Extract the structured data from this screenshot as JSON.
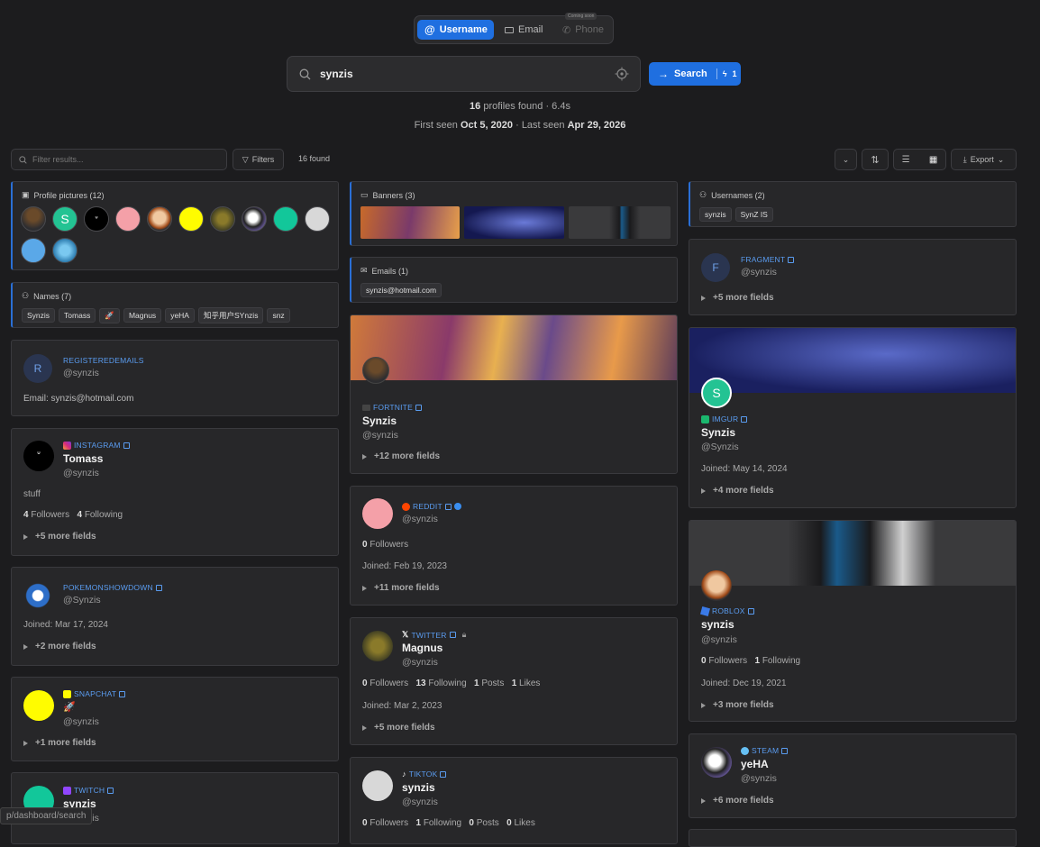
{
  "search_type": {
    "username": "Username",
    "email": "Email",
    "phone": "Phone",
    "phone_badge": "Coming soon"
  },
  "search": {
    "query": "synzis",
    "button": "Search",
    "credits": "1"
  },
  "stats": {
    "profiles_count": "16",
    "profiles_text": "profiles found · 6.4s",
    "first_label": "First seen",
    "first_date": "Oct 5, 2020",
    "sep": "· Last seen",
    "last_date": "Apr 29, 2026"
  },
  "toolbar": {
    "filter_placeholder": "Filter results...",
    "filters": "Filters",
    "found": "16 found",
    "export": "Export"
  },
  "profile_pictures": {
    "title": "Profile pictures (12)"
  },
  "names": {
    "title": "Names (7)",
    "items": [
      "Synzis",
      "Tomass",
      "🚀",
      "Magnus",
      "yeHA",
      "知乎用户SYnzis",
      "snz"
    ]
  },
  "banners": {
    "title": "Banners (3)"
  },
  "emails": {
    "title": "Emails (1)",
    "items": [
      "synzis@hotmail.com"
    ]
  },
  "usernames": {
    "title": "Usernames (2)",
    "items": [
      "synzis",
      "SynZ IS"
    ]
  },
  "registeredemails": {
    "platform": "REGISTEREDEMAILS",
    "avatar_letter": "R",
    "handle": "@synzis",
    "email_line": "Email: synzis@hotmail.com"
  },
  "instagram": {
    "platform": "INSTAGRAM",
    "name": "Tomass",
    "handle": "@synzis",
    "bio": "stuff",
    "followers": "4",
    "followers_label": "Followers",
    "following": "4",
    "following_label": "Following",
    "more": "+5 more fields"
  },
  "pokemon": {
    "platform": "POKEMONSHOWDOWN",
    "handle": "@Synzis",
    "joined": "Joined: Mar 17, 2024",
    "more": "+2 more fields"
  },
  "snapchat": {
    "platform": "SNAPCHAT",
    "name": "🚀",
    "handle": "@synzis",
    "more": "+1 more fields"
  },
  "twitch": {
    "platform": "TWITCH",
    "name": "synzis",
    "handle": "@synzis"
  },
  "fortnite": {
    "platform": "FORTNITE",
    "name": "Synzis",
    "handle": "@synzis",
    "more": "+12 more fields"
  },
  "reddit": {
    "platform": "REDDIT",
    "handle": "@synzis",
    "followers": "0",
    "followers_label": "Followers",
    "joined": "Joined: Feb 19, 2023",
    "more": "+11 more fields"
  },
  "twitter": {
    "platform": "TWITTER",
    "name": "Magnus",
    "handle": "@synzis",
    "followers": "0",
    "followers_label": "Followers",
    "following": "13",
    "following_label": "Following",
    "posts": "1",
    "posts_label": "Posts",
    "likes": "1",
    "likes_label": "Likes",
    "joined": "Joined: Mar 2, 2023",
    "more": "+5 more fields"
  },
  "tiktok": {
    "platform": "TIKTOK",
    "name": "synzis",
    "handle": "@synzis",
    "followers": "0",
    "followers_label": "Followers",
    "following": "1",
    "following_label": "Following",
    "posts": "0",
    "posts_label": "Posts",
    "likes": "0",
    "likes_label": "Likes"
  },
  "fragment": {
    "platform": "FRAGMENT",
    "avatar_letter": "F",
    "handle": "@synzis",
    "more": "+5 more fields"
  },
  "imgur": {
    "platform": "IMGUR",
    "avatar_letter": "S",
    "name": "Synzis",
    "handle": "@Synzis",
    "joined": "Joined: May 14, 2024",
    "more": "+4 more fields"
  },
  "roblox": {
    "platform": "ROBLOX",
    "name": "synzis",
    "handle": "@synzis",
    "followers": "0",
    "followers_label": "Followers",
    "following": "1",
    "following_label": "Following",
    "joined": "Joined: Dec 19, 2021",
    "more": "+3 more fields"
  },
  "steam": {
    "platform": "STEAM",
    "name": "yeHA",
    "handle": "@synzis",
    "more": "+6 more fields"
  },
  "status_url": "p/dashboard/search"
}
